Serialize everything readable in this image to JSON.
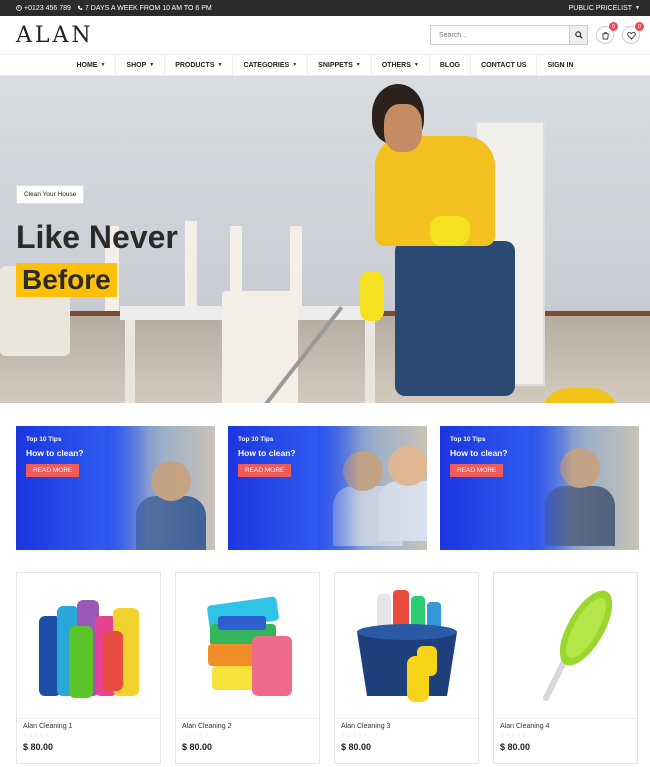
{
  "topbar": {
    "phone": "+0123 456 789",
    "hours": "7 DAYS A WEEK FROM 10 AM TO 6 PM",
    "pricelist": "PUBLIC PRICELIST"
  },
  "header": {
    "logo": "ALAN",
    "search_placeholder": "Search...",
    "cart_count": "0",
    "wishlist_count": "0"
  },
  "nav": {
    "items": [
      {
        "label": "HOME",
        "dropdown": true
      },
      {
        "label": "SHOP",
        "dropdown": true
      },
      {
        "label": "PRODUCTS",
        "dropdown": true
      },
      {
        "label": "CATEGORIES",
        "dropdown": true
      },
      {
        "label": "SNIPPETS",
        "dropdown": true
      },
      {
        "label": "OTHERS",
        "dropdown": true
      },
      {
        "label": "BLOG",
        "dropdown": false
      },
      {
        "label": "CONTACT US",
        "dropdown": false
      },
      {
        "label": "SIGN IN",
        "dropdown": false
      }
    ]
  },
  "hero": {
    "tag": "Clean Your House",
    "line1": "Like Never",
    "line2": "Before"
  },
  "banners": [
    {
      "top": "Top 10 Tips",
      "title": "How to clean?",
      "button": "READ MORE"
    },
    {
      "top": "Top 10 Tips",
      "title": "How to clean?",
      "button": "READ MORE"
    },
    {
      "top": "Top 10 Tips",
      "title": "How to clean?",
      "button": "READ MORE"
    }
  ],
  "products": [
    {
      "name": "Alan Cleaning 1",
      "price": "$ 80.00",
      "rating": 0
    },
    {
      "name": "Alan Cleaning 2",
      "price": "$ 80.00",
      "rating": 0
    },
    {
      "name": "Alan Cleaning 3",
      "price": "$ 80.00",
      "rating": 0
    },
    {
      "name": "Alan Cleaning 4",
      "price": "$ 80.00",
      "rating": 0
    }
  ],
  "colors": {
    "accent_yellow": "#ffc107",
    "banner_blue": "#1b35e0",
    "read_more": "#ef5a5a",
    "badge": "#e74c5a",
    "topbar": "#2b2b2b"
  }
}
